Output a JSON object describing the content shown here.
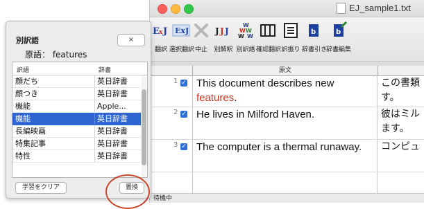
{
  "window": {
    "title": "EJ_sample1.txt"
  },
  "toolbar": {
    "items": [
      {
        "label": "翻訳",
        "icon": "translate-icon"
      },
      {
        "label": "選択翻訳",
        "icon": "selection-translate-icon"
      },
      {
        "label": "中止",
        "icon": "stop-icon"
      },
      {
        "label": "別解釈",
        "icon": "alternate-interpretation-icon"
      },
      {
        "label": "別訳語",
        "icon": "alternate-translation-icon"
      },
      {
        "label": "確認翻訳",
        "icon": "confirm-translation-icon"
      },
      {
        "label": "訳振り",
        "icon": "assign-translation-icon"
      },
      {
        "label": "辞書引き",
        "icon": "dictionary-lookup-icon"
      },
      {
        "label": "辞書編集",
        "icon": "dictionary-edit-icon"
      }
    ]
  },
  "doc_table": {
    "source_header": "原文",
    "rows": [
      {
        "num": "1",
        "source_a": "This document describes new ",
        "source_red": "features",
        "source_b": ".",
        "target_1": "この書類",
        "target_2": "す。"
      },
      {
        "num": "2",
        "source_a": "He lives in Milford Haven.",
        "source_red": "",
        "source_b": "",
        "target_1": "彼はミル",
        "target_2": "ます。"
      },
      {
        "num": "3",
        "source_a": "The computer is a thermal runaway.",
        "source_red": "",
        "source_b": "",
        "target_1": "コンピュ",
        "target_2": ""
      }
    ]
  },
  "status": "待機中",
  "alt_panel": {
    "title": "別訳語",
    "close_label": "×",
    "source": "原語： features",
    "col_translation": "訳語",
    "col_dictionary": "辞書",
    "rows": [
      {
        "translation": "顔だち",
        "dictionary": "英日辞書"
      },
      {
        "translation": "顔つき",
        "dictionary": "英日辞書"
      },
      {
        "translation": "機能",
        "dictionary": "Apple..."
      },
      {
        "translation": "機能",
        "dictionary": "英日辞書",
        "selected": true
      },
      {
        "translation": "長編映画",
        "dictionary": "英日辞書"
      },
      {
        "translation": "特集記事",
        "dictionary": "英日辞書"
      },
      {
        "translation": "特性",
        "dictionary": "英日辞書"
      }
    ],
    "clear_label": "学習をクリア",
    "replace_label": "置換"
  },
  "colors": {
    "accent": "#2f65d0",
    "highlight_text": "#d1301f",
    "callout": "#c7472c"
  }
}
